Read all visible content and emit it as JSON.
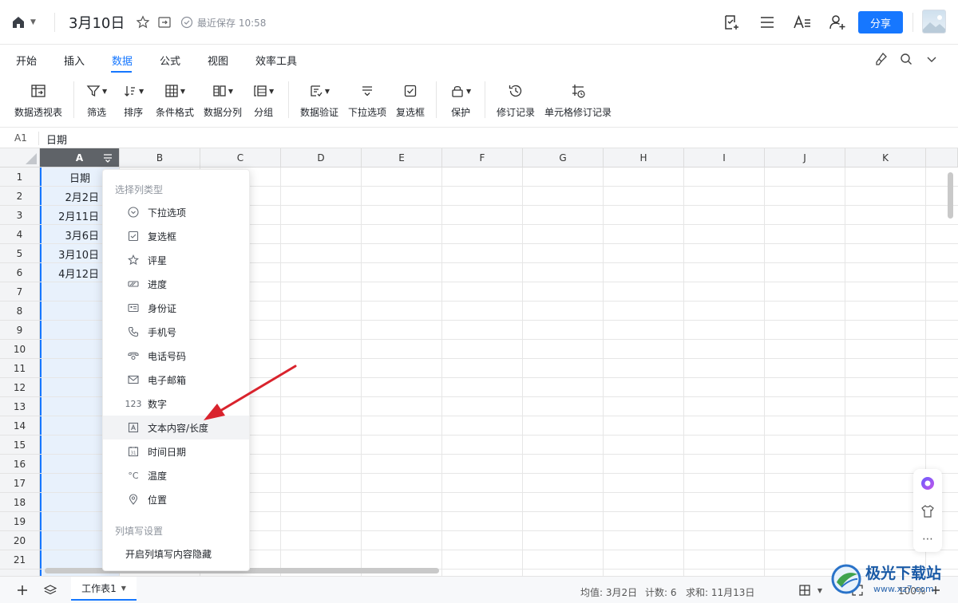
{
  "titlebar": {
    "doc_title": "3月10日",
    "save_status": "最近保存 10:58",
    "share_label": "分享"
  },
  "tabs": [
    {
      "label": "开始"
    },
    {
      "label": "插入"
    },
    {
      "label": "数据",
      "active": true
    },
    {
      "label": "公式"
    },
    {
      "label": "视图"
    },
    {
      "label": "效率工具"
    }
  ],
  "toolbar": {
    "pivot": "数据透视表",
    "filter": "筛选",
    "sort": "排序",
    "conditional_format": "条件格式",
    "split": "数据分列",
    "group": "分组",
    "validation": "数据验证",
    "dropdown": "下拉选项",
    "checkbox": "复选框",
    "protect": "保护",
    "history": "修订记录",
    "cell_history": "单元格修订记录"
  },
  "formula_bar": {
    "cell_ref": "A1",
    "content": "日期"
  },
  "grid": {
    "columns": [
      "A",
      "B",
      "C",
      "D",
      "E",
      "F",
      "G",
      "H",
      "I",
      "J",
      "K"
    ],
    "rows": [
      "1",
      "2",
      "3",
      "4",
      "5",
      "6",
      "7",
      "8",
      "9",
      "10",
      "11",
      "12",
      "13",
      "14",
      "15",
      "16",
      "17",
      "18",
      "19",
      "20",
      "21"
    ],
    "col_a": {
      "header": "日期",
      "values": [
        "2月2日",
        "2月11日",
        "3月6日",
        "3月10日",
        "4月12日"
      ]
    }
  },
  "menu": {
    "section_type": "选择列类型",
    "items": [
      {
        "icon": "dropdown-circle-icon",
        "label": "下拉选项"
      },
      {
        "icon": "checkbox-icon",
        "label": "复选框"
      },
      {
        "icon": "star-icon",
        "label": "评星"
      },
      {
        "icon": "progress-icon",
        "label": "进度"
      },
      {
        "icon": "id-card-icon",
        "label": "身份证"
      },
      {
        "icon": "phone-icon",
        "label": "手机号"
      },
      {
        "icon": "telephone-icon",
        "label": "电话号码"
      },
      {
        "icon": "mail-icon",
        "label": "电子邮箱"
      },
      {
        "icon": "number-icon",
        "label": "数字",
        "glyph": "123"
      },
      {
        "icon": "text-icon",
        "label": "文本内容/长度"
      },
      {
        "icon": "calendar-icon",
        "label": "时间日期"
      },
      {
        "icon": "temperature-icon",
        "label": "温度",
        "glyph": "°C"
      },
      {
        "icon": "location-icon",
        "label": "位置"
      }
    ],
    "section_fill": "列填写设置",
    "fill_option": "开启列填写内容隐藏"
  },
  "statusbar": {
    "sheet_name": "工作表1",
    "average": "均值: 3月2日",
    "count": "计数: 6",
    "sum": "求和: 11月13日",
    "zoom": "100%"
  },
  "watermark": {
    "text": "极光下载站",
    "url": "www.xz7.com"
  },
  "colors": {
    "accent": "#1677ff",
    "arrow": "#d9232d",
    "selected_header": "#5f6368"
  }
}
